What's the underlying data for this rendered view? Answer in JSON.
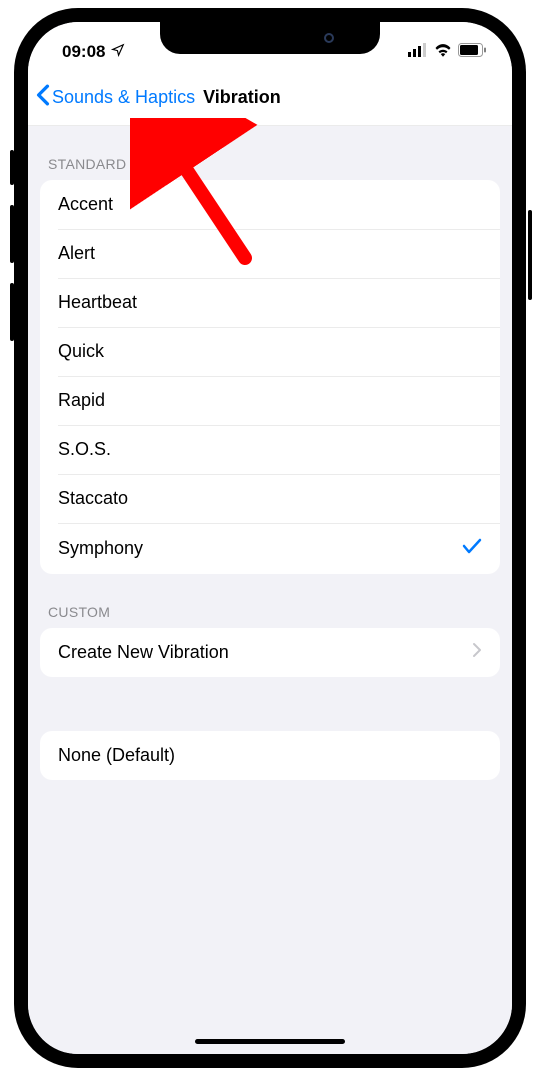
{
  "status": {
    "time": "09:08",
    "location_icon": "location-arrow",
    "signal_icon": "cellular-signal",
    "wifi_icon": "wifi-signal",
    "battery_icon": "battery"
  },
  "nav": {
    "back_label": "Sounds & Haptics",
    "title": "Vibration"
  },
  "sections": [
    {
      "header": "STANDARD",
      "items": [
        {
          "label": "Accent",
          "selected": false
        },
        {
          "label": "Alert",
          "selected": false
        },
        {
          "label": "Heartbeat",
          "selected": false
        },
        {
          "label": "Quick",
          "selected": false
        },
        {
          "label": "Rapid",
          "selected": false
        },
        {
          "label": "S.O.S.",
          "selected": false
        },
        {
          "label": "Staccato",
          "selected": false
        },
        {
          "label": "Symphony",
          "selected": true
        }
      ]
    },
    {
      "header": "CUSTOM",
      "items": [
        {
          "label": "Create New Vibration",
          "disclosure": true
        }
      ]
    },
    {
      "header": "",
      "items": [
        {
          "label": "None (Default)",
          "selected": false
        }
      ]
    }
  ],
  "annotation": {
    "arrow_color": "#ff0000"
  }
}
